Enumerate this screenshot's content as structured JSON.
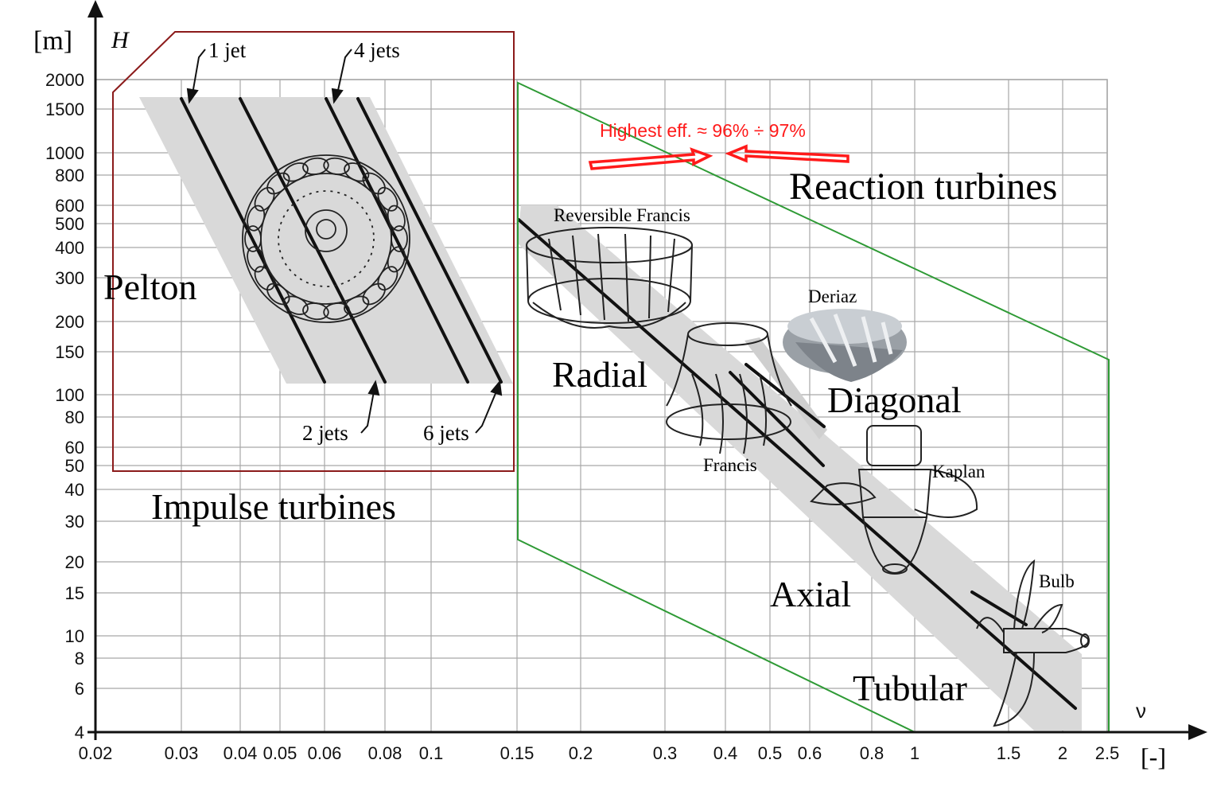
{
  "axes": {
    "y_unit": "[m]",
    "y_symbol": "H",
    "x_unit": "[-]",
    "x_symbol": "ν",
    "y_ticks": [
      "2000",
      "1500",
      "1000",
      "800",
      "600",
      "500",
      "400",
      "300",
      "200",
      "150",
      "100",
      "80",
      "60",
      "50",
      "40",
      "30",
      "20",
      "15",
      "10",
      "8",
      "6",
      "4"
    ],
    "x_ticks": [
      "0.02",
      "0.03",
      "0.04",
      "0.05",
      "0.06",
      "0.08",
      "0.1",
      "0.15",
      "0.2",
      "0.3",
      "0.4",
      "0.5",
      "0.6",
      "0.8",
      "1",
      "1.5",
      "2",
      "2.5"
    ]
  },
  "groups": {
    "impulse": {
      "label": "Impulse turbines",
      "color": "#8b1a1a"
    },
    "reaction": {
      "label": "Reaction turbines",
      "color": "#2e9a35"
    }
  },
  "impulse_labels": {
    "pelton": "Pelton",
    "jet1": "1 jet",
    "jet2": "2 jets",
    "jet4": "4 jets",
    "jet6": "6 jets"
  },
  "reaction_labels": {
    "reversible_francis": "Reversible Francis",
    "radial": "Radial",
    "deriaz": "Deriaz",
    "francis": "Francis",
    "diagonal": "Diagonal",
    "kaplan": "Kaplan",
    "axial": "Axial",
    "bulb": "Bulb",
    "tubular": "Tubular"
  },
  "efficiency_note": {
    "text": "Highest eff. ≈ 96% ÷ 97%",
    "color": "#ff1a1a"
  }
}
